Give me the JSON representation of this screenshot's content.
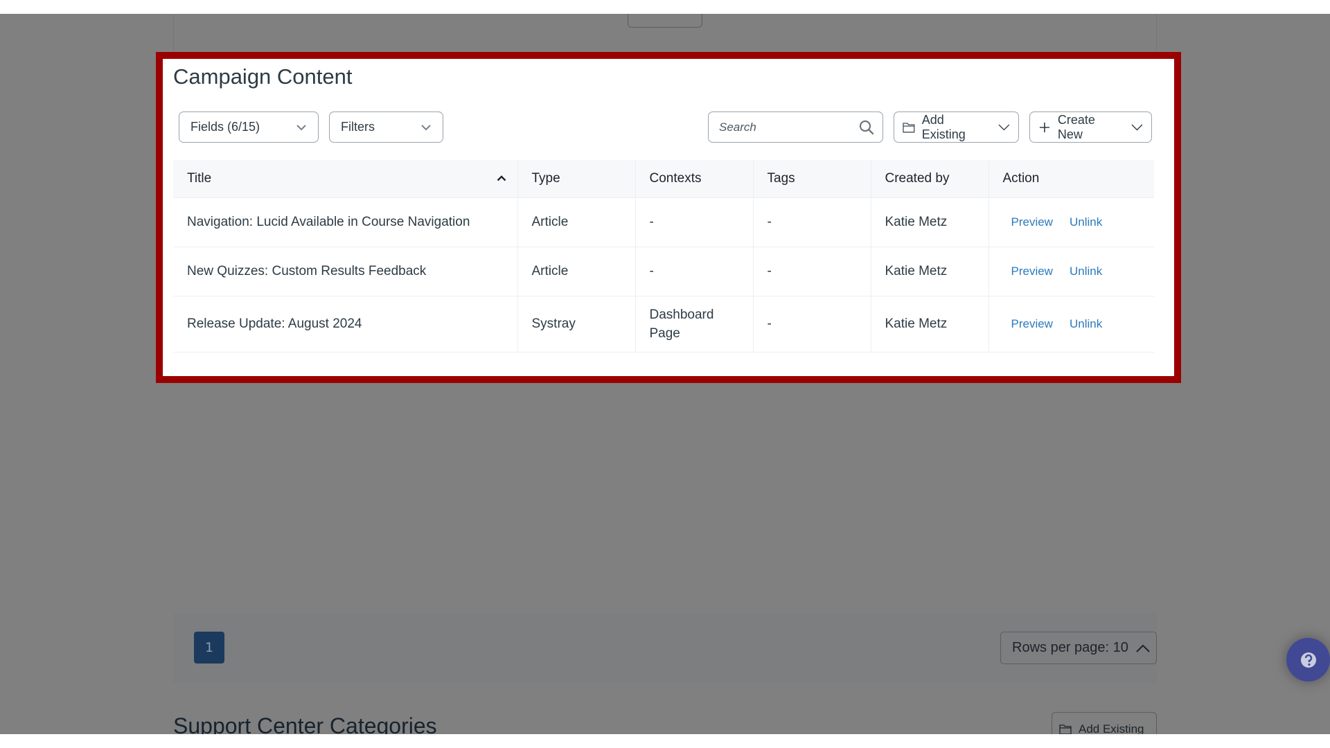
{
  "page": {
    "background_overlay_color": "#808080",
    "highlight_color": "#9b0000"
  },
  "campaign_content": {
    "title": "Campaign Content",
    "toolbar": {
      "fields_label": "Fields (6/15)",
      "filters_label": "Filters",
      "search_placeholder": "Search",
      "search_value": "",
      "add_existing_label": "Add Existing",
      "create_new_label": "Create New"
    },
    "table": {
      "columns": [
        "Title",
        "Type",
        "Contexts",
        "Tags",
        "Created by",
        "Action"
      ],
      "sort": {
        "column": "Title",
        "direction": "ascending"
      },
      "rows": [
        {
          "title": "Navigation: Lucid Available in Course Navigation",
          "type": "Article",
          "contexts": "-",
          "tags": "-",
          "created_by": "Katie Metz",
          "actions": [
            "Preview",
            "Unlink"
          ]
        },
        {
          "title": "New Quizzes: Custom Results Feedback",
          "type": "Article",
          "contexts": "-",
          "tags": "-",
          "created_by": "Katie Metz",
          "actions": [
            "Preview",
            "Unlink"
          ]
        },
        {
          "title": "Release Update: August 2024",
          "type": "Systray",
          "contexts": "Dashboard Page",
          "tags": "-",
          "created_by": "Katie Metz",
          "actions": [
            "Preview",
            "Unlink"
          ]
        }
      ]
    },
    "link_color": "#2b7abc"
  },
  "pagination": {
    "current_page": "1",
    "rows_per_page_label": "Rows per page: 10"
  },
  "support_center": {
    "title": "Support Center Categories",
    "add_existing_label": "Add Existing"
  },
  "help_button": {
    "icon": "help-question-icon",
    "color": "#414994"
  }
}
